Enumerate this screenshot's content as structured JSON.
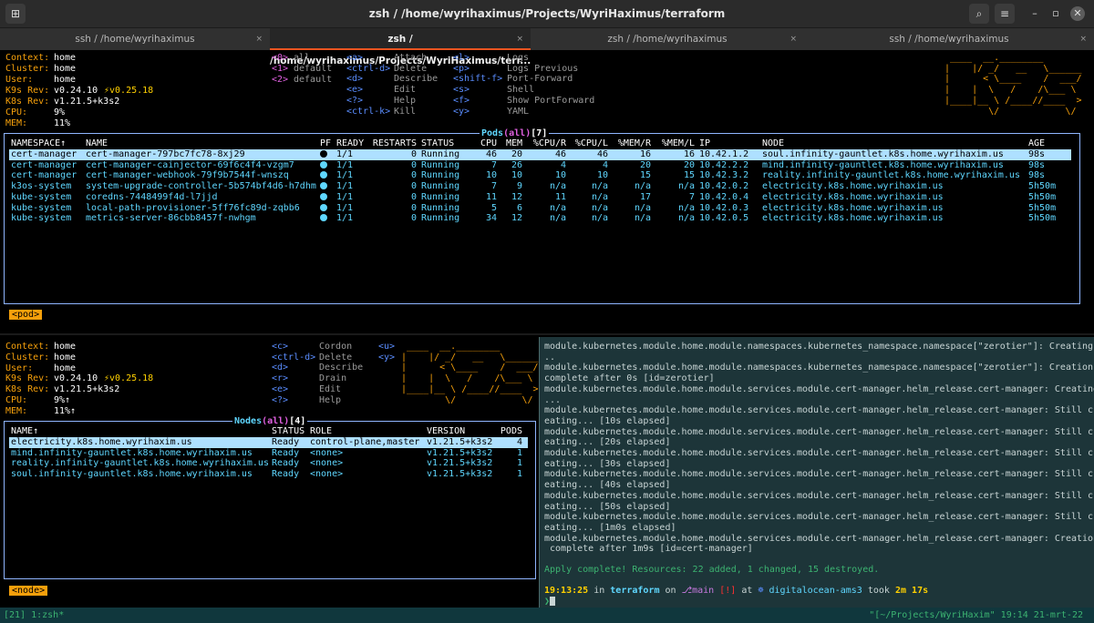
{
  "window": {
    "title": "zsh / /home/wyrihaximus/Projects/WyriHaximus/terraform",
    "menu_icon": "hamburger-icon",
    "search_icon": "search-icon",
    "new_tab_icon": "new-tab-icon"
  },
  "tabs": [
    {
      "label": "ssh / /home/wyrihaximus",
      "close": "×"
    },
    {
      "label": "zsh / /home/wyrihaximus/Projects/WyriHaximus/terr...",
      "close": "×"
    },
    {
      "label": "zsh / /home/wyrihaximus",
      "close": "×"
    },
    {
      "label": "ssh / /home/wyrihaximus",
      "close": "×"
    }
  ],
  "top": {
    "info": {
      "context_label": "Context:",
      "context": "home",
      "cluster_label": "Cluster:",
      "cluster": "home",
      "user_label": "User:",
      "user": "home",
      "k9s_label": "K9s Rev:",
      "k9s": "v0.24.10",
      "k9s_upgrade": "⚡v0.25.18",
      "k8s_label": "K8s Rev:",
      "k8s": "v1.21.5+k3s2",
      "cpu_label": "CPU:",
      "cpu": "9%",
      "mem_label": "MEM:",
      "mem": "11%"
    },
    "ns_keys": [
      {
        "key": "<0>",
        "label": "all"
      },
      {
        "key": "<1>",
        "label": "default"
      },
      {
        "key": "<2>",
        "label": "default"
      }
    ],
    "hotkeys1": [
      {
        "key": "<a>",
        "label": "Attach"
      },
      {
        "key": "<ctrl-d>",
        "label": "Delete"
      },
      {
        "key": "<d>",
        "label": "Describe"
      },
      {
        "key": "<e>",
        "label": "Edit"
      },
      {
        "key": "<?>",
        "label": "Help"
      },
      {
        "key": "<ctrl-k>",
        "label": "Kill"
      }
    ],
    "hotkeys2": [
      {
        "key": "<l>",
        "label": "Logs"
      },
      {
        "key": "<p>",
        "label": "Logs Previous"
      },
      {
        "key": "<shift-f>",
        "label": "Port-Forward"
      },
      {
        "key": "<s>",
        "label": "Shell"
      },
      {
        "key": "<f>",
        "label": "Show PortForward"
      },
      {
        "key": "<y>",
        "label": "YAML"
      }
    ],
    "table_title": {
      "name": "Pods",
      "scope": "all",
      "count": "7"
    },
    "columns": [
      "NAMESPACE↑",
      "NAME",
      "PF",
      "READY",
      "RESTARTS",
      "STATUS",
      "CPU",
      "MEM",
      "%CPU/R",
      "%CPU/L",
      "%MEM/R",
      "%MEM/L",
      "IP",
      "NODE",
      "AGE"
    ],
    "rows": [
      [
        "cert-manager",
        "cert-manager-797bc7fc78-8xj29",
        "●",
        "1/1",
        "0",
        "Running",
        "46",
        "20",
        "46",
        "46",
        "16",
        "16",
        "10.42.1.2",
        "soul.infinity-gauntlet.k8s.home.wyrihaxim.us",
        "98s"
      ],
      [
        "cert-manager",
        "cert-manager-cainjector-69f6c4f4-vzgm7",
        "●",
        "1/1",
        "0",
        "Running",
        "7",
        "26",
        "4",
        "4",
        "20",
        "20",
        "10.42.2.2",
        "mind.infinity-gauntlet.k8s.home.wyrihaxim.us",
        "98s"
      ],
      [
        "cert-manager",
        "cert-manager-webhook-79f9b7544f-wnszq",
        "●",
        "1/1",
        "0",
        "Running",
        "10",
        "10",
        "10",
        "10",
        "15",
        "15",
        "10.42.3.2",
        "reality.infinity-gauntlet.k8s.home.wyrihaxim.us",
        "98s"
      ],
      [
        "k3os-system",
        "system-upgrade-controller-5b574bf4d6-h7dhm",
        "●",
        "1/1",
        "0",
        "Running",
        "7",
        "9",
        "n/a",
        "n/a",
        "n/a",
        "n/a",
        "10.42.0.2",
        "electricity.k8s.home.wyrihaxim.us",
        "5h50m"
      ],
      [
        "kube-system",
        "coredns-7448499f4d-l7jjd",
        "●",
        "1/1",
        "0",
        "Running",
        "11",
        "12",
        "11",
        "n/a",
        "17",
        "7",
        "10.42.0.4",
        "electricity.k8s.home.wyrihaxim.us",
        "5h50m"
      ],
      [
        "kube-system",
        "local-path-provisioner-5ff76fc89d-zqbb6",
        "●",
        "1/1",
        "0",
        "Running",
        "5",
        "6",
        "n/a",
        "n/a",
        "n/a",
        "n/a",
        "10.42.0.3",
        "electricity.k8s.home.wyrihaxim.us",
        "5h50m"
      ],
      [
        "kube-system",
        "metrics-server-86cbb8457f-nwhgm",
        "●",
        "1/1",
        "0",
        "Running",
        "34",
        "12",
        "n/a",
        "n/a",
        "n/a",
        "n/a",
        "10.42.0.5",
        "electricity.k8s.home.wyrihaxim.us",
        "5h50m"
      ]
    ],
    "crumb": "<pod>"
  },
  "bottom": {
    "info": {
      "context_label": "Context:",
      "context": "home",
      "cluster_label": "Cluster:",
      "cluster": "home",
      "user_label": "User:",
      "user": "home",
      "k9s_label": "K9s Rev:",
      "k9s": "v0.24.10",
      "k9s_upgrade": "⚡v0.25.18",
      "k8s_label": "K8s Rev:",
      "k8s": "v1.21.5+k3s2",
      "cpu_label": "CPU:",
      "cpu": "9%↑",
      "mem_label": "MEM:",
      "mem": "11%↑"
    },
    "hotkeys1": [
      {
        "key": "<c>",
        "label": "Cordon"
      },
      {
        "key": "<ctrl-d>",
        "label": "Delete"
      },
      {
        "key": "<d>",
        "label": "Describe"
      },
      {
        "key": "<r>",
        "label": "Drain"
      },
      {
        "key": "<e>",
        "label": "Edit"
      },
      {
        "key": "<?>",
        "label": "Help"
      }
    ],
    "hotkeys2": [
      {
        "key": "<u>",
        "label": ""
      },
      {
        "key": "<y>",
        "label": ""
      }
    ],
    "table_title": {
      "name": "Nodes",
      "scope": "all",
      "count": "4"
    },
    "columns": [
      "NAME↑",
      "STATUS",
      "ROLE",
      "VERSION",
      "PODS"
    ],
    "rows": [
      [
        "electricity.k8s.home.wyrihaxim.us",
        "Ready",
        "control-plane,master",
        "v1.21.5+k3s2",
        "4"
      ],
      [
        "mind.infinity-gauntlet.k8s.home.wyrihaxim.us",
        "Ready",
        "<none>",
        "v1.21.5+k3s2",
        "1"
      ],
      [
        "reality.infinity-gauntlet.k8s.home.wyrihaxim.us",
        "Ready",
        "<none>",
        "v1.21.5+k3s2",
        "1"
      ],
      [
        "soul.infinity-gauntlet.k8s.home.wyrihaxim.us",
        "Ready",
        "<none>",
        "v1.21.5+k3s2",
        "1"
      ]
    ],
    "crumb": "<node>"
  },
  "terraform": {
    "lines": [
      "module.kubernetes.module.home.module.namespaces.kubernetes_namespace.namespace[\"zerotier\"]: Creating.",
      "..",
      "module.kubernetes.module.home.module.namespaces.kubernetes_namespace.namespace[\"zerotier\"]: Creation",
      "complete after 0s [id=zerotier]",
      "module.kubernetes.module.home.module.services.module.cert-manager.helm_release.cert-manager: Creating",
      "...",
      "module.kubernetes.module.home.module.services.module.cert-manager.helm_release.cert-manager: Still cr",
      "eating... [10s elapsed]",
      "module.kubernetes.module.home.module.services.module.cert-manager.helm_release.cert-manager: Still cr",
      "eating... [20s elapsed]",
      "module.kubernetes.module.home.module.services.module.cert-manager.helm_release.cert-manager: Still cr",
      "eating... [30s elapsed]",
      "module.kubernetes.module.home.module.services.module.cert-manager.helm_release.cert-manager: Still cr",
      "eating... [40s elapsed]",
      "module.kubernetes.module.home.module.services.module.cert-manager.helm_release.cert-manager: Still cr",
      "eating... [50s elapsed]",
      "module.kubernetes.module.home.module.services.module.cert-manager.helm_release.cert-manager: Still cr",
      "eating... [1m0s elapsed]",
      "module.kubernetes.module.home.module.services.module.cert-manager.helm_release.cert-manager: Creation",
      " complete after 1m9s [id=cert-manager]"
    ],
    "apply": "Apply complete! Resources: 22 added, 1 changed, 15 destroyed.",
    "prompt": {
      "time": "19:13:25",
      "in": "in",
      "dir": "terraform",
      "on": "on",
      "branch": "main",
      "dirty": "[!]",
      "at": "at",
      "ctx_icon": "helm-icon",
      "ctx": "digitalocean-ams3",
      "took": "took",
      "duration": "2m 17s",
      "arrow": "❯"
    }
  },
  "tmux": {
    "left": "[21] 1:zsh*",
    "right": "\"[~/Projects/WyriHaxim\" 19:14 21-mrt-22"
  }
}
